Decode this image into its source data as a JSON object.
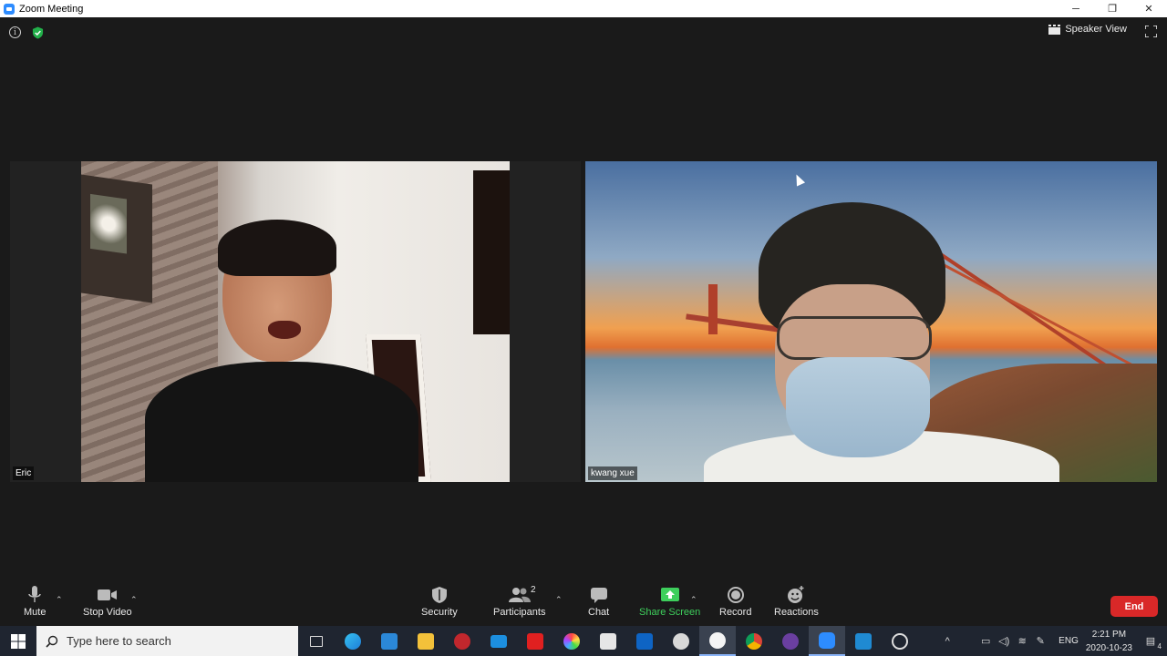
{
  "window": {
    "title": "Zoom Meeting",
    "controls": [
      "─",
      "❐",
      "✕"
    ]
  },
  "top_bar": {
    "view_label": "Speaker View"
  },
  "participants": [
    {
      "name": "Eric"
    },
    {
      "name": "kwang xue"
    }
  ],
  "toolbar": {
    "mute": "Mute",
    "stop_video": "Stop Video",
    "security": "Security",
    "participants": "Participants",
    "participants_count": "2",
    "chat": "Chat",
    "share_screen": "Share Screen",
    "record": "Record",
    "reactions": "Reactions",
    "end": "End"
  },
  "taskbar": {
    "search_placeholder": "Type here to search",
    "lang": "ENG",
    "time": "2:21 PM",
    "date": "2020-10-23",
    "notification_count": "4",
    "apps": [
      "task-view-icon",
      "edge-icon",
      "store-icon",
      "file-explorer-icon",
      "app-red-icon",
      "mail-icon",
      "youdao-icon",
      "paint-icon",
      "bag-icon",
      "outlook-icon",
      "chrome-like-icon",
      "wechat-icon",
      "chrome-icon",
      "app-purple-icon",
      "zoom-icon",
      "vscode-icon",
      "obs-icon"
    ]
  },
  "colors": {
    "end": "#d92828",
    "share": "#3ecf5c",
    "accent": "#2d8cff"
  }
}
